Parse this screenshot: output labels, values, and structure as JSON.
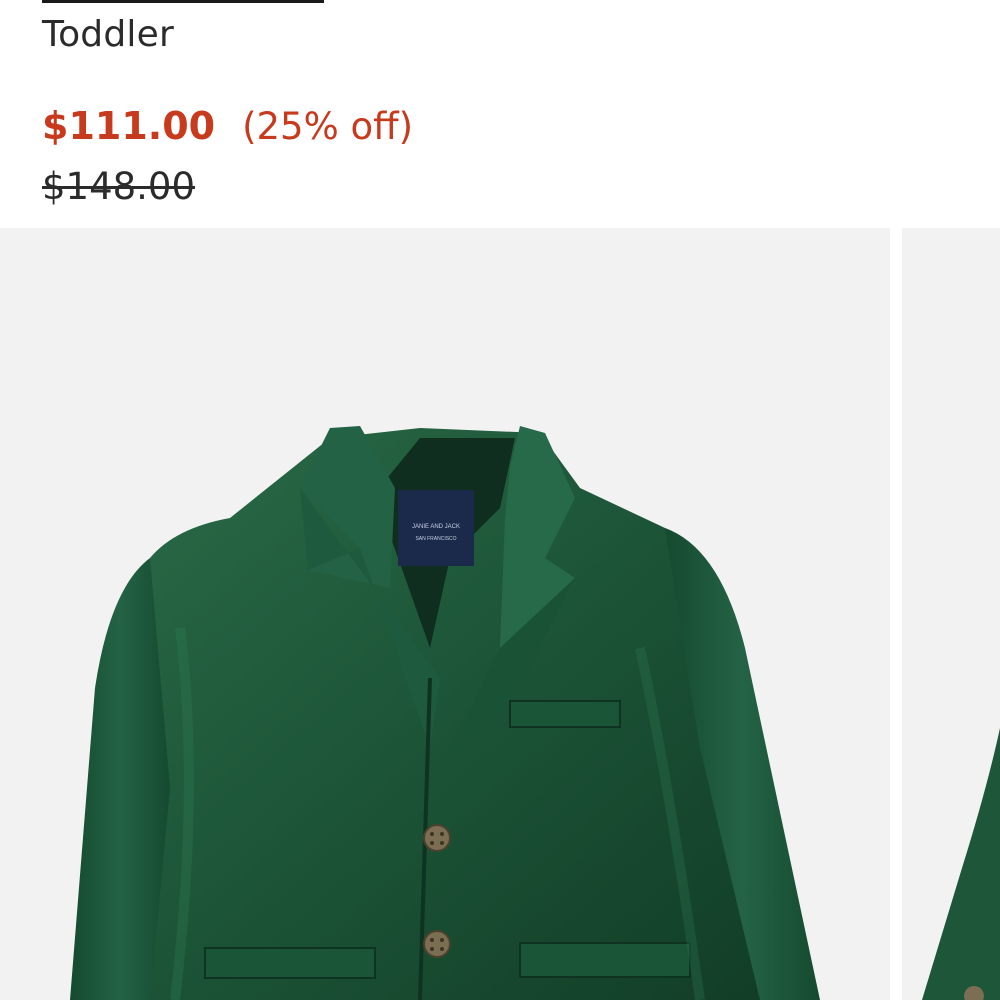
{
  "product": {
    "size_category": "Toddler",
    "sale_price": "$111.00",
    "discount": "(25% off)",
    "original_price": "$148.00"
  },
  "gallery": {
    "label_brand": "JANIE AND JACK",
    "label_city": "SAN FRANCISCO"
  },
  "colors": {
    "sale": "#c73a1d",
    "text": "#2b2b2b",
    "velvet": "#1f5a3c",
    "image_bg": "#f2f2f2"
  }
}
